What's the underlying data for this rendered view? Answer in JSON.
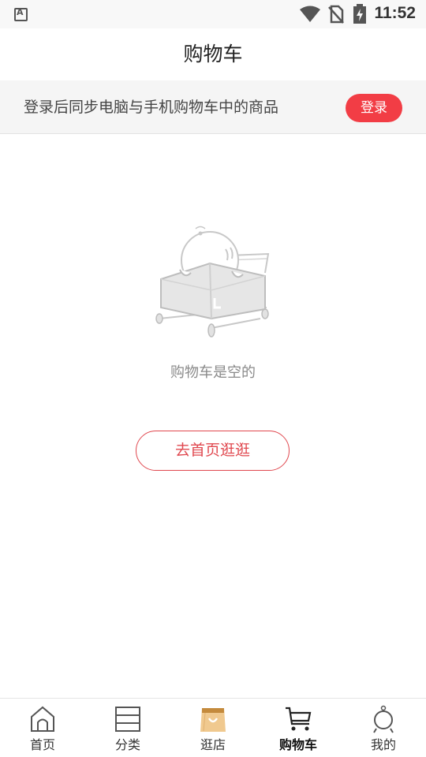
{
  "status_bar": {
    "time": "11:52"
  },
  "header": {
    "title": "购物车"
  },
  "login_banner": {
    "tip": "登录后同步电脑与手机购物车中的商品",
    "button_label": "登录"
  },
  "empty_state": {
    "message": "购物车是空的",
    "button_label": "去首页逛逛"
  },
  "tab_bar": {
    "active_index": 3,
    "tabs": [
      {
        "label": "首页",
        "icon": "home-icon"
      },
      {
        "label": "分类",
        "icon": "category-icon"
      },
      {
        "label": "逛店",
        "icon": "shopping-bag-icon"
      },
      {
        "label": "购物车",
        "icon": "cart-icon"
      },
      {
        "label": "我的",
        "icon": "profile-icon"
      }
    ]
  },
  "colors": {
    "accent": "#f23d45",
    "button_outline": "#e0484f",
    "banner_bg": "#f5f5f5"
  }
}
